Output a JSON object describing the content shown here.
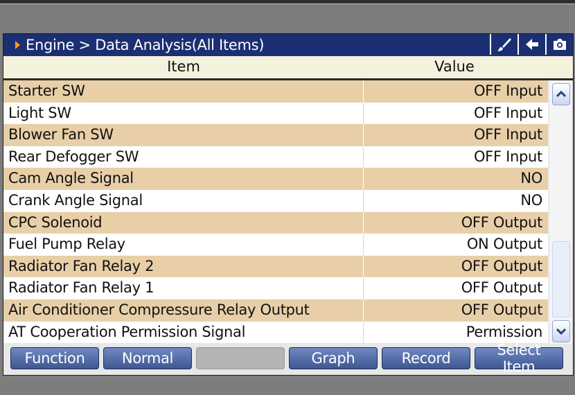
{
  "title": {
    "breadcrumb": "Engine > Data Analysis(All Items)"
  },
  "title_icons": [
    "brush-icon",
    "back-arrow-icon",
    "camera-icon"
  ],
  "columns": {
    "item": "Item",
    "value": "Value"
  },
  "rows": [
    {
      "item": "Starter SW",
      "value": "OFF Input"
    },
    {
      "item": "Light SW",
      "value": "OFF Input"
    },
    {
      "item": "Blower Fan SW",
      "value": "OFF Input"
    },
    {
      "item": "Rear Defogger SW",
      "value": "OFF Input"
    },
    {
      "item": "Cam Angle Signal",
      "value": "NO"
    },
    {
      "item": "Crank Angle Signal",
      "value": "NO"
    },
    {
      "item": "CPC Solenoid",
      "value": "OFF Output"
    },
    {
      "item": "Fuel Pump Relay",
      "value": "ON Output"
    },
    {
      "item": "Radiator Fan Relay 2",
      "value": "OFF Output"
    },
    {
      "item": "Radiator Fan Relay 1",
      "value": "OFF Output"
    },
    {
      "item": "Air Conditioner Compressure Relay Output",
      "value": "OFF Output"
    },
    {
      "item": "AT Cooperation Permission Signal",
      "value": "Permission"
    }
  ],
  "buttons": {
    "function": "Function",
    "normal": "Normal",
    "blank": "",
    "graph": "Graph",
    "record": "Record",
    "select_item": "Select Item"
  },
  "colors": {
    "title_bar": "#1c2f73",
    "row_highlight": "#e8cfa8",
    "button_blue": "#4f68a4",
    "accent_arrow": "#ff9a1f"
  }
}
